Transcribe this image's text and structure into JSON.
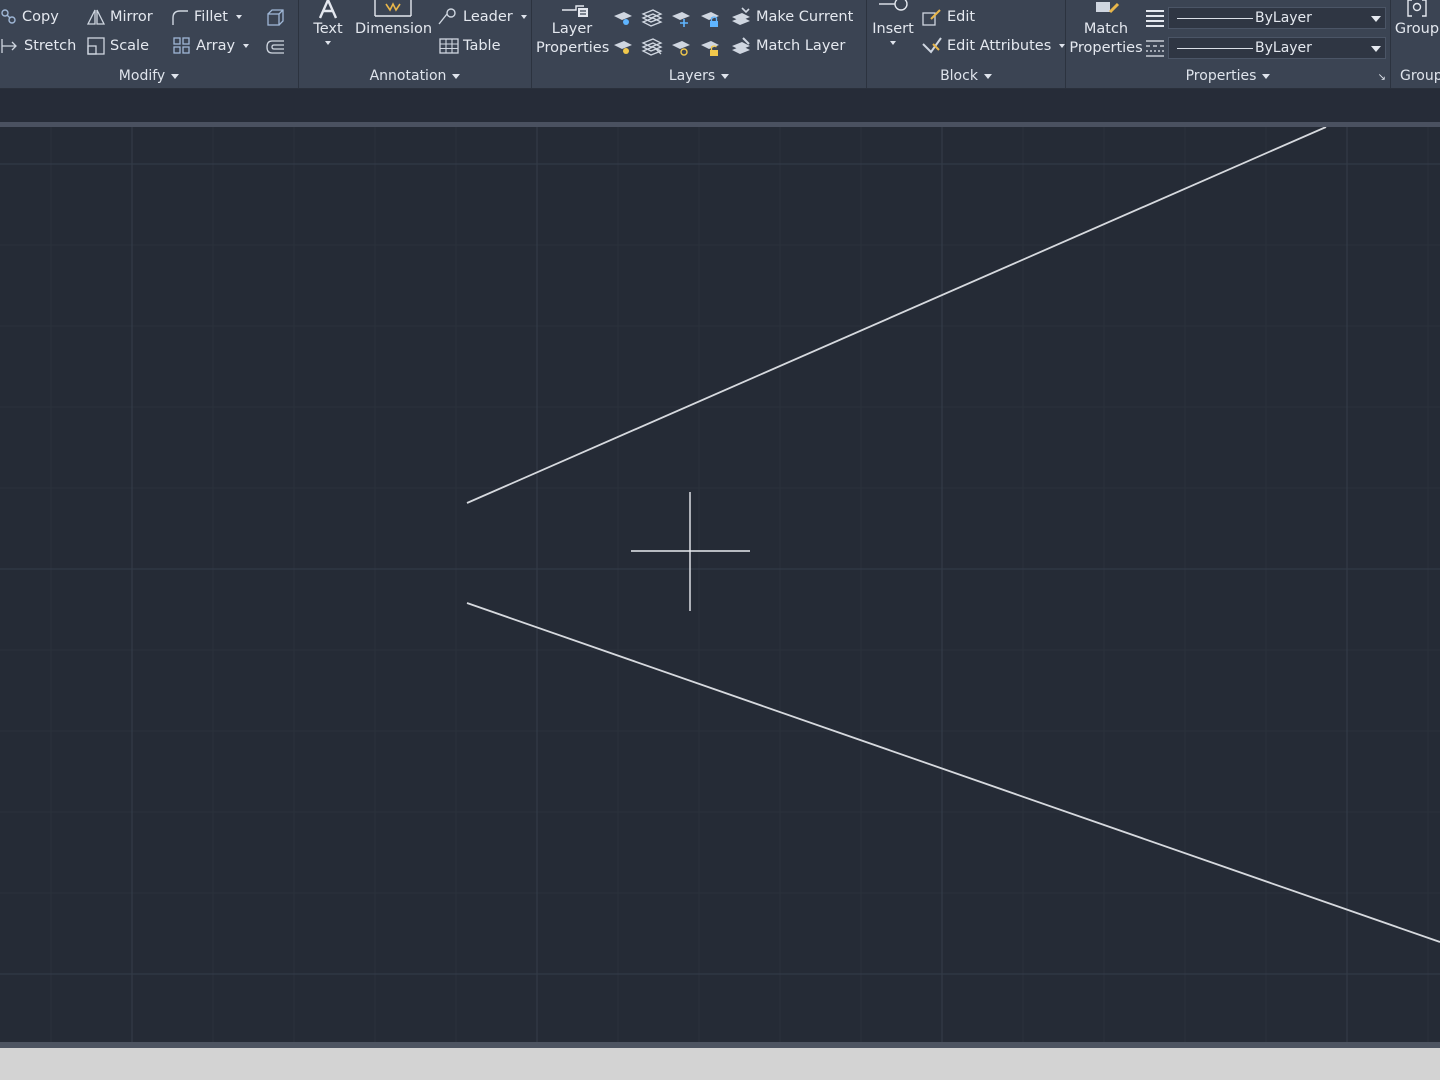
{
  "ribbon": {
    "modify": {
      "title": "Modify",
      "copy": "Copy",
      "mirror": "Mirror",
      "fillet": "Fillet",
      "stretch": "Stretch",
      "scale": "Scale",
      "array": "Array"
    },
    "annotation": {
      "title": "Annotation",
      "text": "Text",
      "dimension": "Dimension",
      "leader": "Leader",
      "table": "Table"
    },
    "layers": {
      "title": "Layers",
      "layer_properties_1": "Layer",
      "layer_properties_2": "Properties",
      "make_current": "Make Current",
      "match_layer": "Match Layer"
    },
    "block": {
      "title": "Block",
      "insert": "Insert",
      "edit": "Edit",
      "edit_attributes": "Edit Attributes"
    },
    "properties": {
      "title": "Properties",
      "match_properties_1": "Match",
      "match_properties_2": "Properties",
      "lineweight_value": "ByLayer",
      "linetype_value": "ByLayer"
    },
    "groups": {
      "title": "Group",
      "group": "Group"
    }
  },
  "colors": {
    "ribbon_bg": "#3b4453",
    "canvas_bg": "#252b36",
    "grid_major": "#323a47",
    "grid_minor": "#2a313c",
    "geometry": "#d6d9de",
    "crosshair": "#e8ebef",
    "status_bg": "#d3d3d3"
  }
}
